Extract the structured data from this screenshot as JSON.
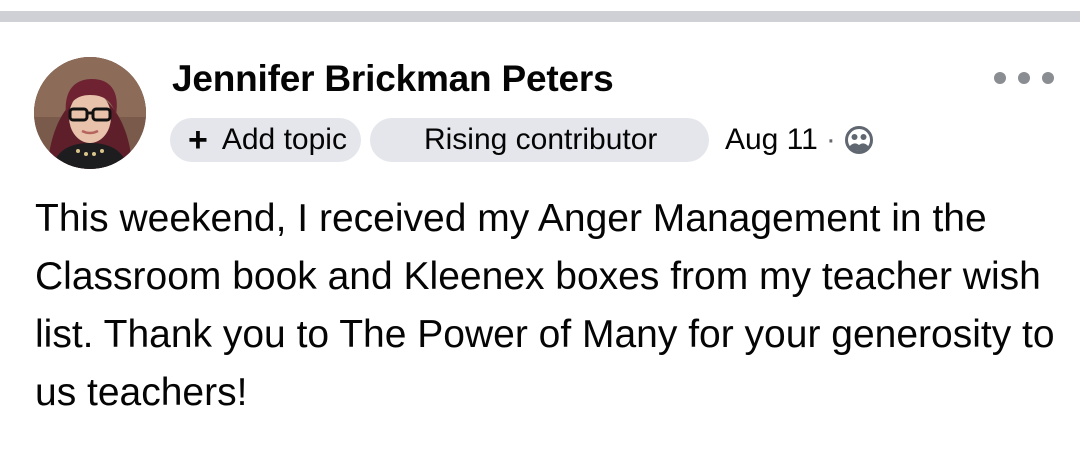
{
  "post": {
    "author": "Jennifer Brickman Peters",
    "add_topic_label": "Add topic",
    "add_topic_icon": "plus-icon",
    "badge_label": "Rising contributor",
    "date": "Aug 11",
    "separator": "·",
    "privacy_icon": "friends-privacy-icon",
    "more_icon": "more-options-icon",
    "body": "This weekend, I received my Anger Management in the Classroom book and Kleenex boxes from my teacher wish list. Thank you to The Power of Many for your generosity to us teachers!"
  },
  "colors": {
    "divider": "#cfd0d6",
    "chip_background": "#e4e6eb",
    "text": "#050505",
    "secondary_text": "#65676b"
  }
}
